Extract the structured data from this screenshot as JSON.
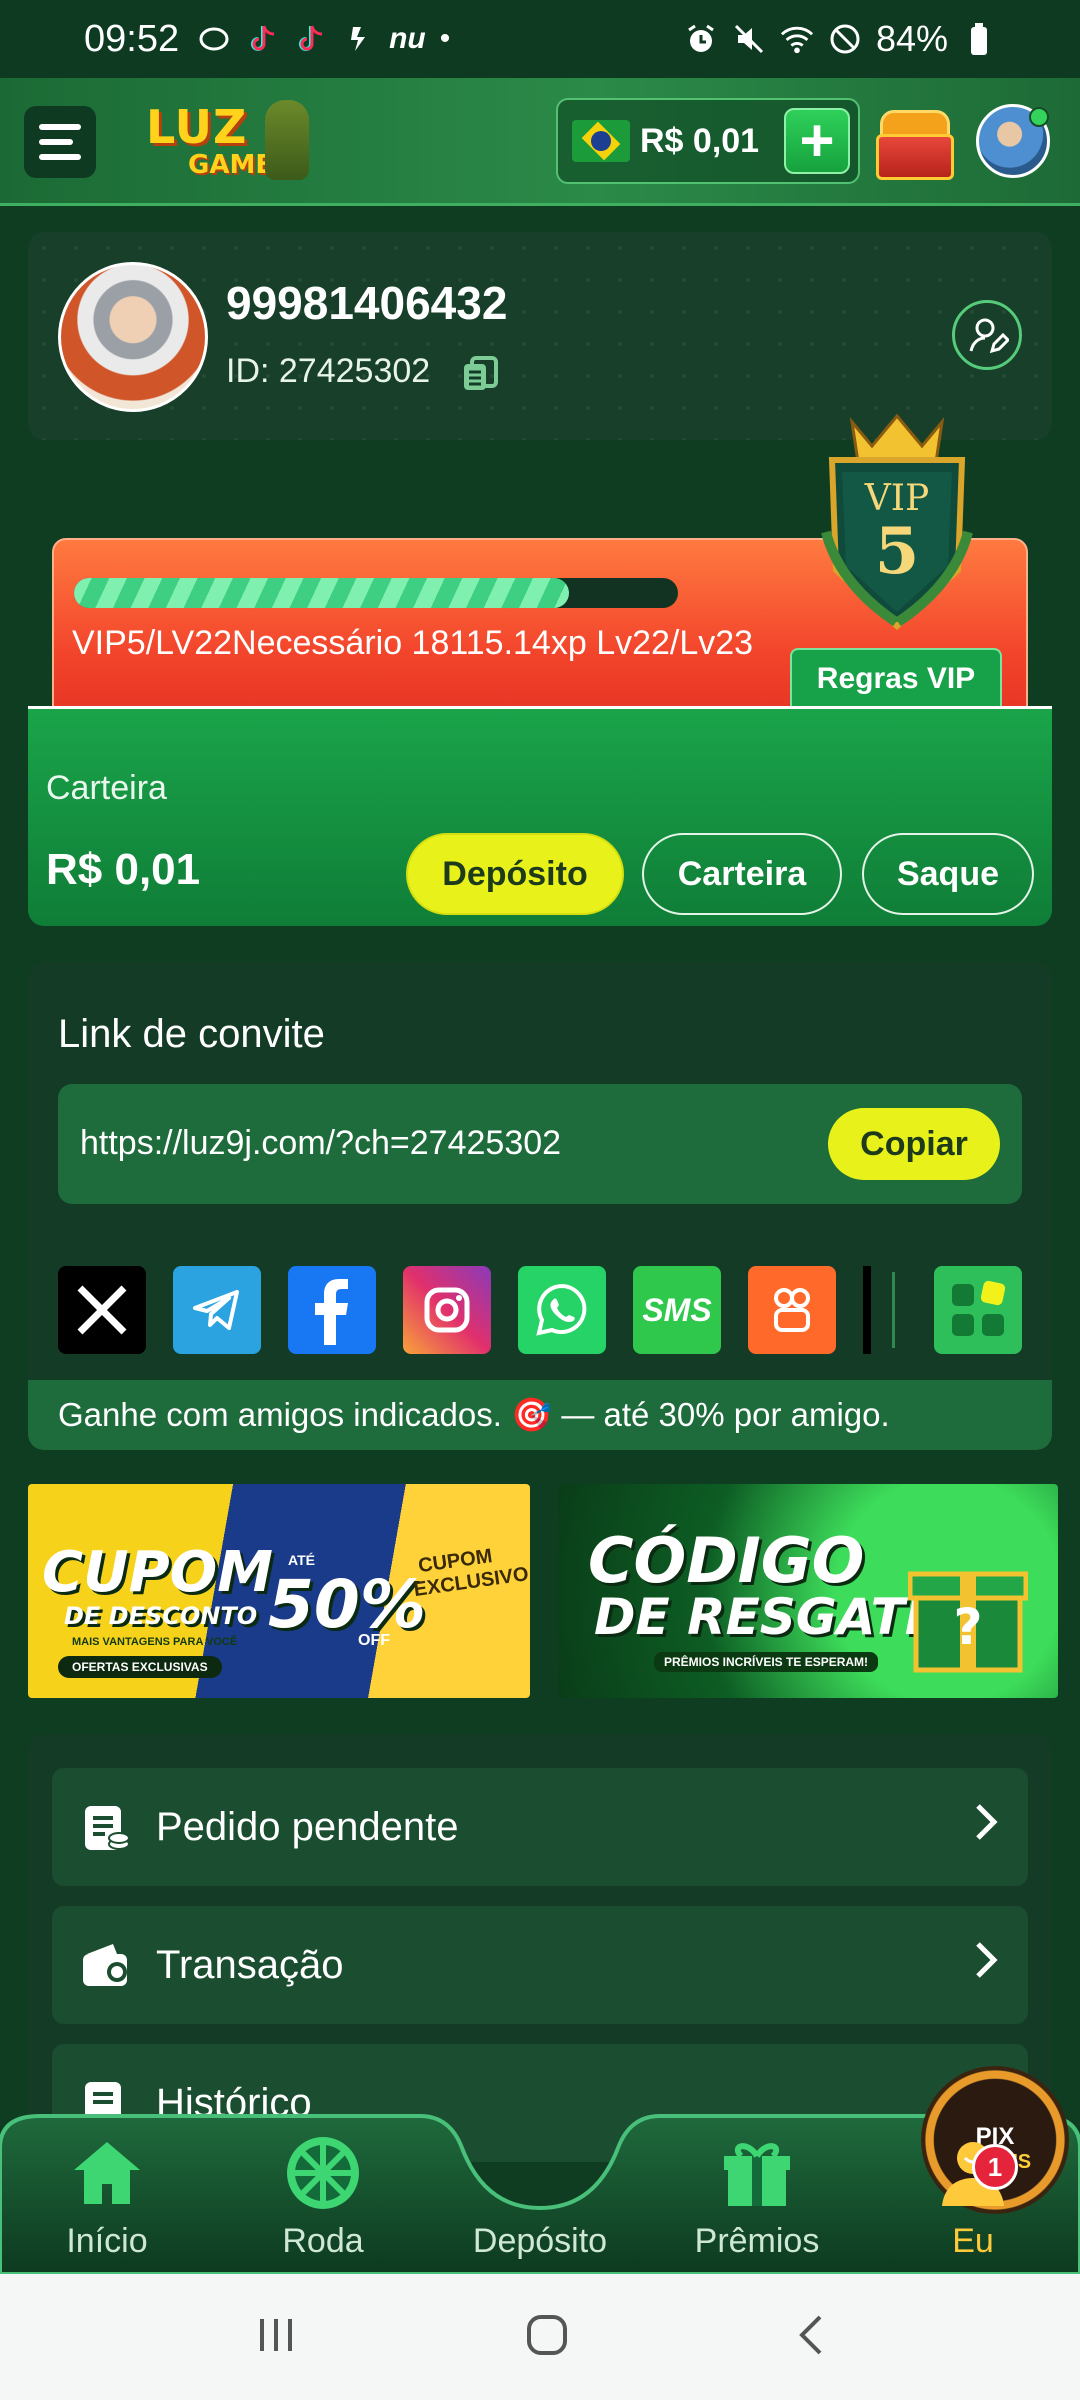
{
  "status_bar": {
    "time": "09:52",
    "notif_nu": "nu",
    "notif_dot": "•",
    "battery": "84%",
    "icons": [
      "whatsapp-business-icon",
      "tiktok-icon",
      "tiktok-icon",
      "nubank-flash-icon",
      "alarm-icon",
      "mute-icon",
      "wifi-icon",
      "dnd-icon",
      "battery-icon"
    ]
  },
  "header": {
    "logo_line1": "LUZ",
    "logo_line2": "GAMES",
    "balance": "R$ 0,01",
    "deposit_plus": "+"
  },
  "profile": {
    "username": "99981406432",
    "id_label": "ID: 27425302"
  },
  "vip": {
    "progress_fraction": 0.82,
    "status_text": "VIP5/LV22Necessário 18115.14xp Lv22/Lv23",
    "rules_label": "Regras VIP",
    "badge_title": "VIP",
    "badge_level": "5"
  },
  "wallet": {
    "label": "Carteira",
    "value": "R$ 0,01",
    "deposit_button": "Depósito",
    "wallet_button": "Carteira",
    "withdraw_button": "Saque"
  },
  "invite": {
    "title": "Link de convite",
    "url": "https://luz9j.com/?ch=27425302",
    "copy_button": "Copiar",
    "share": [
      {
        "name": "x-icon",
        "glyph": "𝕏",
        "color": "#000000"
      },
      {
        "name": "telegram-icon",
        "glyph": "➤",
        "color": "#2aa3e0"
      },
      {
        "name": "facebook-icon",
        "glyph": "f",
        "color": "#1877f2"
      },
      {
        "name": "instagram-icon",
        "glyph": "◎",
        "color": "#e1306c"
      },
      {
        "name": "whatsapp-icon",
        "glyph": "✆",
        "color": "#25d366"
      },
      {
        "name": "sms-icon",
        "glyph": "SMS",
        "color": "#2fc84c"
      },
      {
        "name": "kwai-icon",
        "glyph": "⌘",
        "color": "#ff6a2a"
      }
    ],
    "earn_text": "Ganhe com amigos indicados. 🎯 — até 30% por amigo."
  },
  "banners": {
    "coupon_title": "CUPOM",
    "coupon_sub": "DE DESCONTO",
    "coupon_small": "MAIS VANTAGENS PARA VOCÊ",
    "coupon_offers": "OFERTAS EXCLUSIVAS",
    "coupon_ate": "ATÉ",
    "coupon_pct": "50%",
    "coupon_off": "OFF",
    "coupon_excl": "CUPOM EXCLUSIVO",
    "code_title": "CÓDIGO",
    "code_sub": "DE RESGATE",
    "code_small": "PRÊMIOS INCRÍVEIS TE ESPERAM!"
  },
  "menu": [
    {
      "label": "Pedido pendente",
      "icon": "pending-order-icon"
    },
    {
      "label": "Transação",
      "icon": "wallet-transaction-icon"
    },
    {
      "label": "Histórico",
      "icon": "history-icon"
    }
  ],
  "bottom_nav": {
    "home": "Início",
    "wheel": "Roda",
    "deposit": "Depósito",
    "prizes": "Prêmios",
    "me": "Eu",
    "me_badge": "1",
    "pix_top": "PIX",
    "pix_bottom": "BÔNUS"
  },
  "colors": {
    "bg": "#0f3d22",
    "accent_yellow": "#e8f21a",
    "active_tab": "#ffc93c",
    "vip_orange": "#f2432b"
  }
}
